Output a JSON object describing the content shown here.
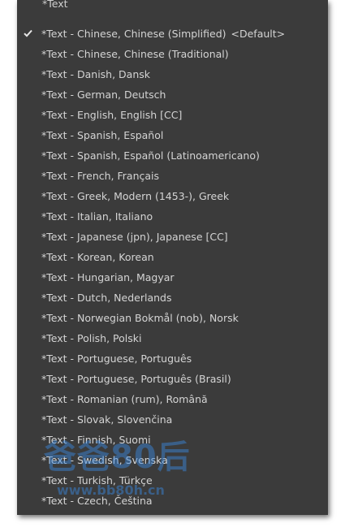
{
  "menu": {
    "cut_item_label": "*Text",
    "items": [
      {
        "label": "*Text - Chinese, Chinese (Simplified)",
        "default_tag": "<Default>",
        "checked": true
      },
      {
        "label": "*Text - Chinese, Chinese (Traditional)",
        "default_tag": "",
        "checked": false
      },
      {
        "label": "*Text - Danish, Dansk",
        "default_tag": "",
        "checked": false
      },
      {
        "label": "*Text - German, Deutsch",
        "default_tag": "",
        "checked": false
      },
      {
        "label": "*Text - English, English [CC]",
        "default_tag": "",
        "checked": false
      },
      {
        "label": "*Text - Spanish, Español",
        "default_tag": "",
        "checked": false
      },
      {
        "label": "*Text - Spanish, Español (Latinoamericano)",
        "default_tag": "",
        "checked": false
      },
      {
        "label": "*Text - French, Français",
        "default_tag": "",
        "checked": false
      },
      {
        "label": "*Text - Greek, Modern (1453-), Greek",
        "default_tag": "",
        "checked": false
      },
      {
        "label": "*Text - Italian, Italiano",
        "default_tag": "",
        "checked": false
      },
      {
        "label": "*Text - Japanese (jpn), Japanese [CC]",
        "default_tag": "",
        "checked": false
      },
      {
        "label": "*Text - Korean, Korean",
        "default_tag": "",
        "checked": false
      },
      {
        "label": "*Text - Hungarian, Magyar",
        "default_tag": "",
        "checked": false
      },
      {
        "label": "*Text - Dutch, Nederlands",
        "default_tag": "",
        "checked": false
      },
      {
        "label": "*Text - Norwegian Bokmål (nob), Norsk",
        "default_tag": "",
        "checked": false
      },
      {
        "label": "*Text - Polish, Polski",
        "default_tag": "",
        "checked": false
      },
      {
        "label": "*Text - Portuguese, Português",
        "default_tag": "",
        "checked": false
      },
      {
        "label": "*Text - Portuguese, Português (Brasil)",
        "default_tag": "",
        "checked": false
      },
      {
        "label": "*Text - Romanian (rum), Română",
        "default_tag": "",
        "checked": false
      },
      {
        "label": "*Text - Slovak, Slovenčina",
        "default_tag": "",
        "checked": false
      },
      {
        "label": "*Text - Finnish, Suomi",
        "default_tag": "",
        "checked": false
      },
      {
        "label": "*Text - Swedish, Svenska",
        "default_tag": "",
        "checked": false
      },
      {
        "label": "*Text - Turkish, Türkçe",
        "default_tag": "",
        "checked": false
      },
      {
        "label": "*Text - Czech, Čeština",
        "default_tag": "",
        "checked": false
      }
    ]
  },
  "watermark": {
    "main_text": "爸爸80后",
    "url_text": "www.bb80h.cn"
  },
  "colors": {
    "menu_background": "#3b3b3b",
    "text": "#d4d4d4",
    "watermark": "#3a8ce6"
  },
  "icons": {
    "checked_item": "checkmark-icon"
  }
}
